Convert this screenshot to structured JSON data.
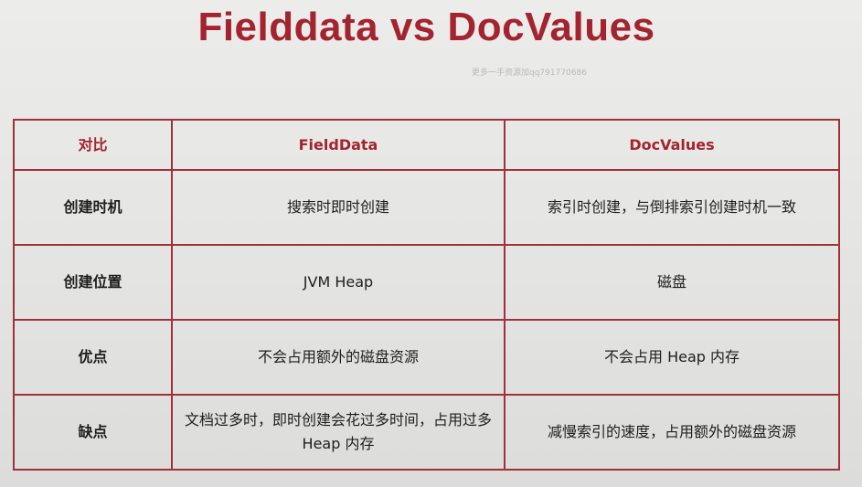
{
  "slide": {
    "title": "Fielddata vs DocValues",
    "watermark": "更多一手资源加qq791770686"
  },
  "table": {
    "headers": [
      "对比",
      "FieldData",
      "DocValues"
    ],
    "rows": [
      {
        "label": "创建时机",
        "fielddata": "搜索时即时创建",
        "docvalues": "索引时创建，与倒排索引创建时机一致"
      },
      {
        "label": "创建位置",
        "fielddata": "JVM Heap",
        "docvalues": "磁盘"
      },
      {
        "label": "优点",
        "fielddata": "不会占用额外的磁盘资源",
        "docvalues": "不会占用 Heap 内存"
      },
      {
        "label": "缺点",
        "fielddata": "文档过多时，即时创建会花过多时间，占用过多 Heap 内存",
        "docvalues": "减慢索引的速度，占用额外的磁盘资源"
      }
    ]
  }
}
